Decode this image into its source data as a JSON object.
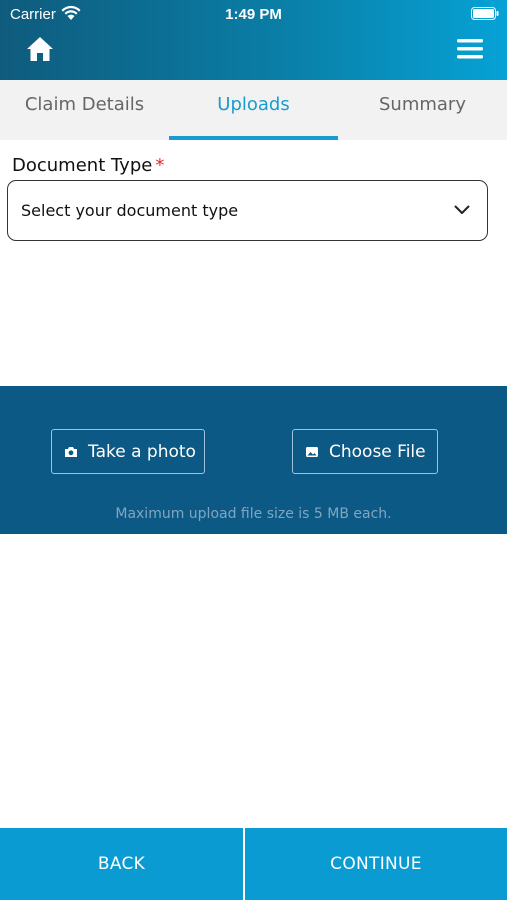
{
  "status_bar": {
    "carrier": "Carrier",
    "time": "1:49 PM"
  },
  "header": {
    "home_icon": "home-icon",
    "menu_icon": "hamburger-menu-icon",
    "gradient_start": "#0f5b7d",
    "gradient_end": "#06a2d6"
  },
  "tabs": [
    {
      "label": "Claim Details",
      "active": false
    },
    {
      "label": "Uploads",
      "active": true
    },
    {
      "label": "Summary",
      "active": false
    }
  ],
  "document_type": {
    "label": "Document Type",
    "required_marker": "*",
    "placeholder": "Select your document type"
  },
  "upload_panel": {
    "take_photo_label": "Take a photo",
    "choose_file_label": "Choose File",
    "note": "Maximum upload file size is 5 MB each.",
    "background": "#0d5985"
  },
  "footer": {
    "back_label": "BACK",
    "continue_label": "CONTINUE",
    "button_color": "#0a9bd3"
  },
  "colors": {
    "accent": "#1a9bd0",
    "required": "#e0282e"
  }
}
